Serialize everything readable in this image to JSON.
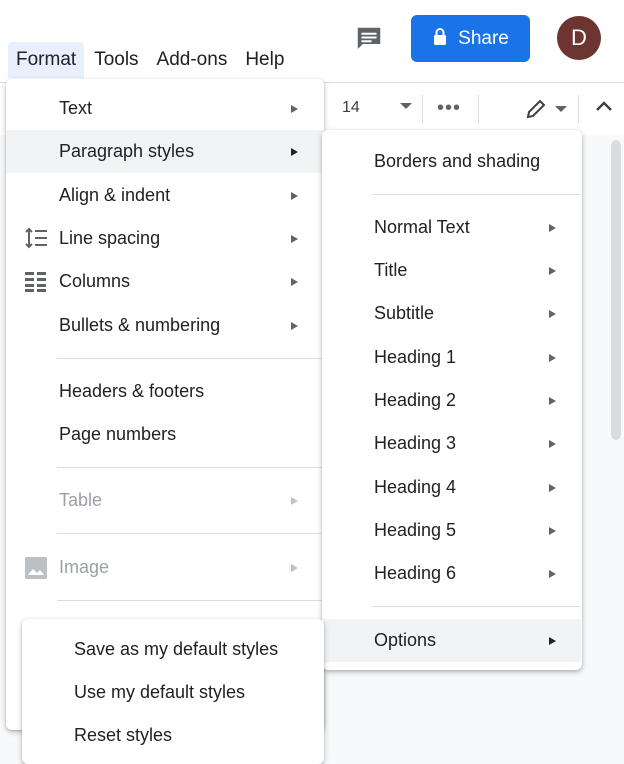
{
  "menubar": {
    "format": "Format",
    "tools": "Tools",
    "addons": "Add-ons",
    "help": "Help"
  },
  "header": {
    "share_label": "Share",
    "avatar_letter": "D"
  },
  "toolbar": {
    "font_size": "14",
    "more": "•••"
  },
  "format_menu": {
    "text": "Text",
    "paragraph_styles": "Paragraph styles",
    "align_indent": "Align & indent",
    "line_spacing": "Line spacing",
    "columns": "Columns",
    "bullets_numbering": "Bullets & numbering",
    "headers_footers": "Headers & footers",
    "page_numbers": "Page numbers",
    "table": "Table",
    "image": "Image"
  },
  "paragraph_submenu": {
    "borders_shading": "Borders and shading",
    "items": [
      "Normal Text",
      "Title",
      "Subtitle",
      "Heading 1",
      "Heading 2",
      "Heading 3",
      "Heading 4",
      "Heading 5",
      "Heading 6"
    ],
    "options": "Options"
  },
  "options_submenu": {
    "save_default": "Save as my default styles",
    "use_default": "Use my default styles",
    "reset": "Reset styles"
  },
  "colors": {
    "accent": "#1a73e8",
    "avatar": "#6d3532",
    "highlight": "#f1f3f4"
  }
}
